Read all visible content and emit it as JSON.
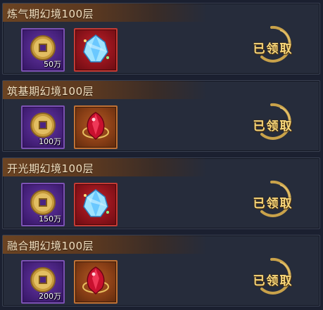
{
  "rewards": [
    {
      "title": "炼气期幻境100层",
      "coin_qty": "50万",
      "gem": "blue-crystal-gem-icon",
      "claim_label": "已领取"
    },
    {
      "title": "筑基期幻境100层",
      "coin_qty": "100万",
      "gem": "red-ruby-gem-icon",
      "claim_label": "已领取"
    },
    {
      "title": "开光期幻境100层",
      "coin_qty": "150万",
      "gem": "blue-crystal-gem-icon",
      "claim_label": "已领取"
    },
    {
      "title": "融合期幻境100层",
      "coin_qty": "200万",
      "gem": "red-ruby-gem-icon",
      "claim_label": "已领取"
    }
  ],
  "colors": {
    "background": "#1b2030",
    "header": "#6b4322",
    "title_text": "#f4e2c3",
    "claim_gold": "#f7d67a"
  }
}
